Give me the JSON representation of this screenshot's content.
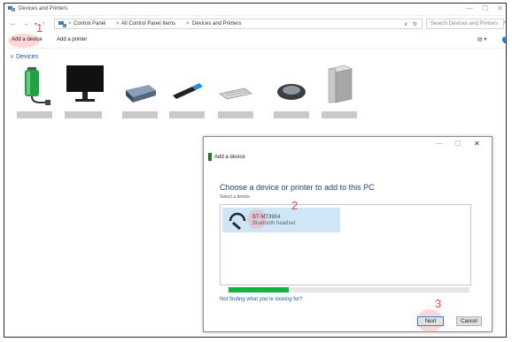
{
  "window": {
    "title": "Devices and Printers"
  },
  "address": {
    "crumbs": [
      "Control Panel",
      "All Control Panel Items",
      "Devices and Printers"
    ],
    "separator": ">",
    "search_placeholder": "Search Devices and Printers"
  },
  "toolbar": {
    "add_device": "Add a device",
    "add_printer": "Add a printer"
  },
  "devices": {
    "group_label": "Devices"
  },
  "dialog": {
    "title": "Add a device",
    "heading": "Choose a device or printer to add to this PC",
    "subheading": "Select a device",
    "device_name": "BT-MT3904",
    "device_type": "Bluetooth headset",
    "progress": 0.25,
    "help_link": "Not finding what you're looking for?",
    "next_label": "Next",
    "cancel_label": "Cancel"
  },
  "steps": [
    "1",
    "2",
    "3"
  ],
  "colors": {
    "accent": "#1e3f7a",
    "progress": "#12b33f",
    "step": "#e24b4b",
    "highlight": "#cfe6f7"
  }
}
